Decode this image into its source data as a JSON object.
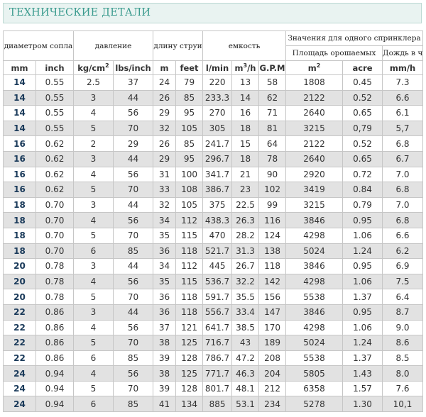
{
  "title": "ТЕХНИЧЕСКИЕ ДЕТАЛИ",
  "groups": {
    "nozzle": "диаметром сопла",
    "pressure": "давление",
    "throw": "длину струи",
    "capacity": "емкость",
    "single": "Значения для одного спринклера",
    "area": "Площадь орошаемых",
    "rain": "Дождь в час"
  },
  "units": [
    "mm",
    "inch",
    "kg/cm²",
    "lbs/inch",
    "m",
    "feet",
    "l/min",
    "m³/h",
    "G.P.M",
    "m²",
    "acre",
    "mm/h"
  ],
  "rows": [
    [
      "14",
      "0.55",
      "2.5",
      "37",
      "24",
      "79",
      "220",
      "13",
      "58",
      "1808",
      "0.45",
      "7.3"
    ],
    [
      "14",
      "0.55",
      "3",
      "44",
      "26",
      "85",
      "233.3",
      "14",
      "62",
      "2122",
      "0.52",
      "6.6"
    ],
    [
      "14",
      "0.55",
      "4",
      "56",
      "29",
      "95",
      "270",
      "16",
      "71",
      "2640",
      "0.65",
      "6.1"
    ],
    [
      "14",
      "0.55",
      "5",
      "70",
      "32",
      "105",
      "305",
      "18",
      "81",
      "3215",
      "0,79",
      "5,7"
    ],
    [
      "16",
      "0.62",
      "2",
      "29",
      "26",
      "85",
      "241.7",
      "15",
      "64",
      "2122",
      "0.52",
      "6.8"
    ],
    [
      "16",
      "0.62",
      "3",
      "44",
      "29",
      "95",
      "296.7",
      "18",
      "78",
      "2640",
      "0.65",
      "6.7"
    ],
    [
      "16",
      "0.62",
      "4",
      "56",
      "31",
      "100",
      "341.7",
      "21",
      "90",
      "2920",
      "0.72",
      "7.0"
    ],
    [
      "16",
      "0.62",
      "5",
      "70",
      "33",
      "108",
      "386.7",
      "23",
      "102",
      "3419",
      "0.84",
      "6.8"
    ],
    [
      "18",
      "0.70",
      "3",
      "44",
      "32",
      "105",
      "375",
      "22.5",
      "99",
      "3215",
      "0.79",
      "7.0"
    ],
    [
      "18",
      "0.70",
      "4",
      "56",
      "34",
      "112",
      "438.3",
      "26.3",
      "116",
      "3846",
      "0.95",
      "6.8"
    ],
    [
      "18",
      "0.70",
      "5",
      "70",
      "35",
      "115",
      "470",
      "28.2",
      "124",
      "4298",
      "1.06",
      "6.6"
    ],
    [
      "18",
      "0.70",
      "6",
      "85",
      "36",
      "118",
      "521.7",
      "31.3",
      "138",
      "5024",
      "1.24",
      "6.2"
    ],
    [
      "20",
      "0.78",
      "3",
      "44",
      "34",
      "112",
      "445",
      "26.7",
      "118",
      "3846",
      "0.95",
      "6.9"
    ],
    [
      "20",
      "0.78",
      "4",
      "56",
      "35",
      "115",
      "536.7",
      "32.2",
      "142",
      "4298",
      "1.06",
      "7.5"
    ],
    [
      "20",
      "0.78",
      "5",
      "70",
      "36",
      "118",
      "591.7",
      "35.5",
      "156",
      "5538",
      "1.37",
      "6.4"
    ],
    [
      "22",
      "0.86",
      "3",
      "44",
      "36",
      "118",
      "556.7",
      "33.4",
      "147",
      "3846",
      "0.95",
      "8.7"
    ],
    [
      "22",
      "0.86",
      "4",
      "56",
      "37",
      "121",
      "641.7",
      "38.5",
      "170",
      "4298",
      "1.06",
      "9.0"
    ],
    [
      "22",
      "0.86",
      "5",
      "70",
      "38",
      "125",
      "716.7",
      "43",
      "189",
      "5024",
      "1.24",
      "8.6"
    ],
    [
      "22",
      "0.86",
      "6",
      "85",
      "39",
      "128",
      "786.7",
      "47.2",
      "208",
      "5538",
      "1.37",
      "8.5"
    ],
    [
      "24",
      "0.94",
      "4",
      "56",
      "38",
      "125",
      "771.7",
      "46.3",
      "204",
      "5805",
      "1.43",
      "8.0"
    ],
    [
      "24",
      "0.94",
      "5",
      "70",
      "39",
      "128",
      "801.7",
      "48.1",
      "212",
      "6358",
      "1.57",
      "7.6"
    ],
    [
      "24",
      "0.94",
      "6",
      "85",
      "41",
      "134",
      "885",
      "53.1",
      "234",
      "5278",
      "1.30",
      "10,1"
    ]
  ]
}
